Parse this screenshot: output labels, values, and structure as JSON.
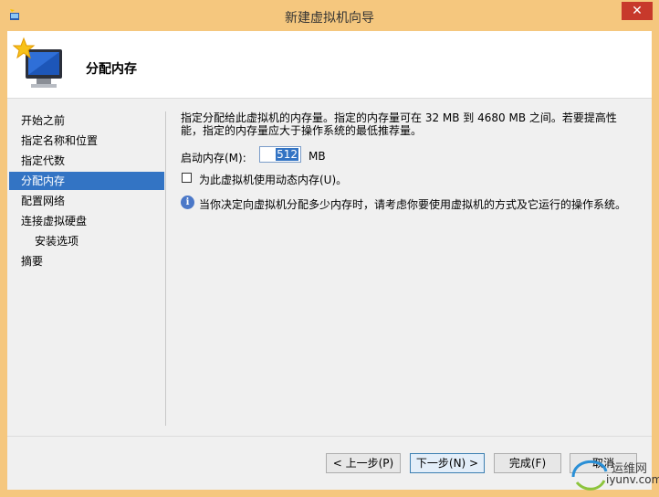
{
  "window": {
    "title": "新建虚拟机向导",
    "close_glyph": "✕",
    "accent": "#3374c4",
    "title_bg": "#f5c77e",
    "close_color": "#c7392b"
  },
  "header": {
    "title": "分配内存",
    "icon": "new-vm-monitor-icon"
  },
  "nav": {
    "items": [
      {
        "label": "开始之前"
      },
      {
        "label": "指定名称和位置"
      },
      {
        "label": "指定代数"
      },
      {
        "label": "分配内存"
      },
      {
        "label": "配置网络"
      },
      {
        "label": "连接虚拟硬盘"
      },
      {
        "label": "安装选项"
      },
      {
        "label": "摘要"
      }
    ]
  },
  "content": {
    "description": "指定分配给此虚拟机的内存量。指定的内存量可在 32 MB 到 4680 MB 之间。若要提高性能，指定的内存量应大于操作系统的最低推荐量。",
    "startup_memory_label": "启动内存(M):",
    "startup_memory_value": "512",
    "memory_unit": "MB",
    "dynamic_memory_label": "为此虚拟机使用动态内存(U)。",
    "dynamic_memory_checked": false,
    "info_icon": "info-icon",
    "info_text": "当你决定向虚拟机分配多少内存时，请考虑你要使用虚拟机的方式及它运行的操作系统。"
  },
  "buttons": {
    "prev": "< 上一步(P)",
    "next": "下一步(N) >",
    "finish": "完成(F)",
    "cancel": "取消"
  },
  "watermark": {
    "text": "iyunv.com",
    "cn": "运维网"
  }
}
